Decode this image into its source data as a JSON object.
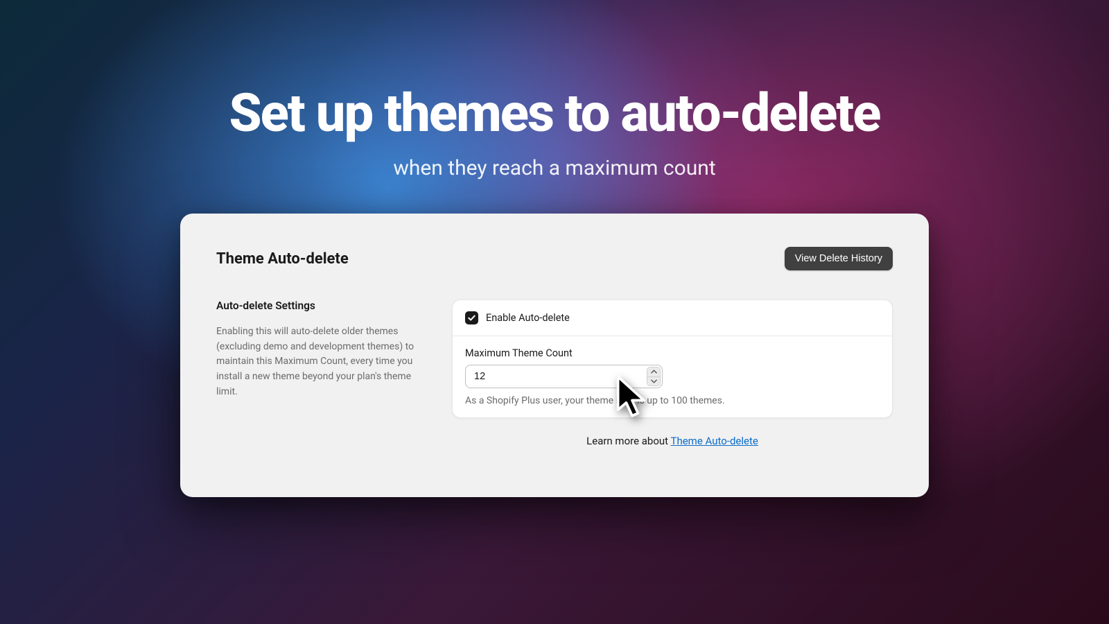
{
  "hero": {
    "title": "Set up themes to auto-delete",
    "subtitle": "when they reach a maximum count"
  },
  "card": {
    "title": "Theme Auto-delete",
    "history_button": "View Delete History",
    "settings_title": "Auto-delete Settings",
    "settings_description": "Enabling this will auto-delete older themes (excluding demo and development themes) to maintain this Maximum Count, every time you install a new theme beyond your plan's theme limit.",
    "enable_label": "Enable Auto-delete",
    "enable_checked": true,
    "max_count_label": "Maximum Theme Count",
    "max_count_value": "12",
    "help_text": "As a Shopify Plus user, your theme limit is up to 100 themes.",
    "learn_more_prefix": "Learn more about ",
    "learn_more_link": "Theme Auto-delete"
  }
}
